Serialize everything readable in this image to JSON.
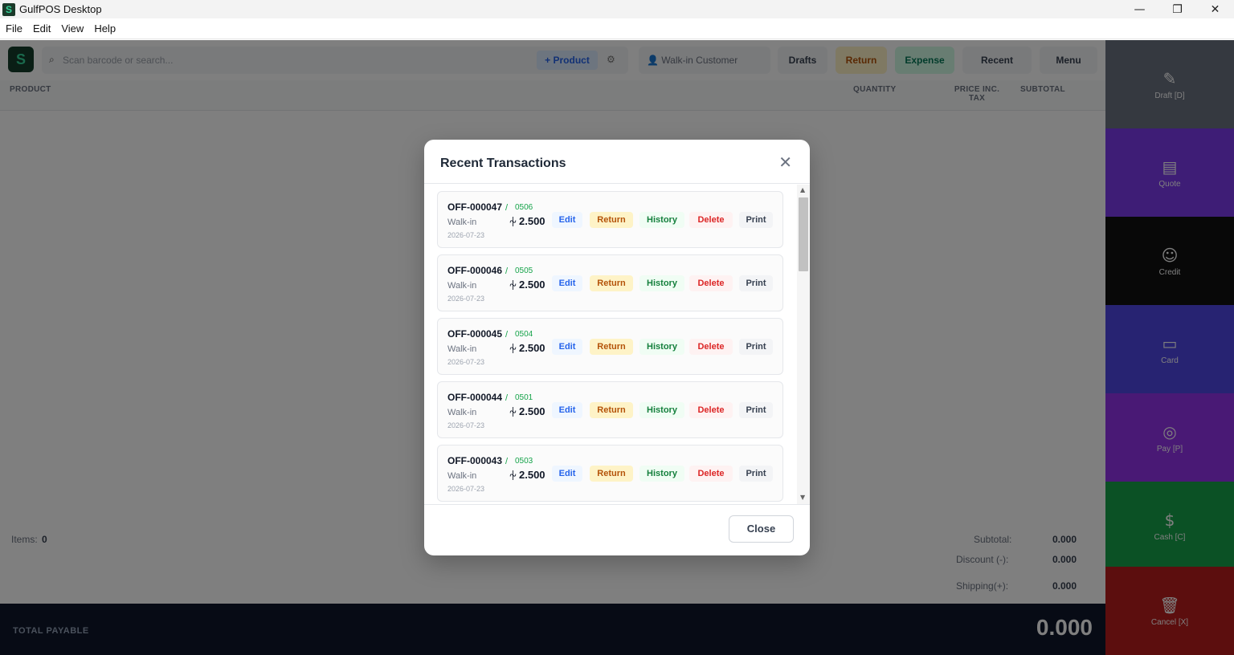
{
  "window": {
    "title": "GulfPOS Desktop",
    "icon_letter": "S",
    "controls": {
      "minimize": "—",
      "maximize": "❐",
      "close": "✕"
    }
  },
  "menubar": [
    "File",
    "Edit",
    "View",
    "Help"
  ],
  "toolbar": {
    "logo_letter": "S",
    "search_placeholder": "Scan barcode or search...",
    "add_product": "+ Product",
    "customer": "Walk-in Customer",
    "drafts": "Drafts",
    "return": "Return",
    "expense": "Expense",
    "recent": "Recent",
    "menu": "Menu"
  },
  "table_headers": {
    "product": "PRODUCT",
    "quantity": "QUANTITY",
    "price": "PRICE INC. TAX",
    "subtotal": "SUBTOTAL"
  },
  "summary": {
    "items_label": "Items:",
    "items_value": "0",
    "subtotal_label": "Subtotal:",
    "subtotal_value": "0.000",
    "discount_label": "Discount (-):",
    "discount_value": "0.000",
    "shipping_label": "Shipping(+):",
    "shipping_value": "0.000"
  },
  "total": {
    "label": "TOTAL PAYABLE",
    "value": "0.000"
  },
  "side_buttons": [
    {
      "label": "Draft [D]",
      "color": "#6b7280"
    },
    {
      "label": "Quote",
      "color": "#7c3aed"
    },
    {
      "label": "Credit",
      "color": "#111111"
    },
    {
      "label": "Card",
      "color": "#4f46e5"
    },
    {
      "label": "Pay [P]",
      "color": "#9333ea"
    },
    {
      "label": "Cash [C]",
      "color": "#16a34a"
    },
    {
      "label": "Cancel [X]",
      "color": "#b91c1c"
    }
  ],
  "modal": {
    "title": "Recent Transactions",
    "close_label": "Close",
    "currency_symbol": "⏆",
    "transactions": [
      {
        "id": "OFF-000047",
        "ref": "0506",
        "customer": "Walk-in",
        "date": "2026-07-23",
        "amount": "2.500"
      },
      {
        "id": "OFF-000046",
        "ref": "0505",
        "customer": "Walk-in",
        "date": "2026-07-23",
        "amount": "2.500"
      },
      {
        "id": "OFF-000045",
        "ref": "0504",
        "customer": "Walk-in",
        "date": "2026-07-23",
        "amount": "2.500"
      },
      {
        "id": "OFF-000044",
        "ref": "0501",
        "customer": "Walk-in",
        "date": "2026-07-23",
        "amount": "2.500"
      },
      {
        "id": "OFF-000043",
        "ref": "0503",
        "customer": "Walk-in",
        "date": "2026-07-23",
        "amount": "2.500"
      }
    ],
    "actions": {
      "edit": "Edit",
      "return": "Return",
      "history": "History",
      "delete": "Delete",
      "print": "Print"
    }
  }
}
